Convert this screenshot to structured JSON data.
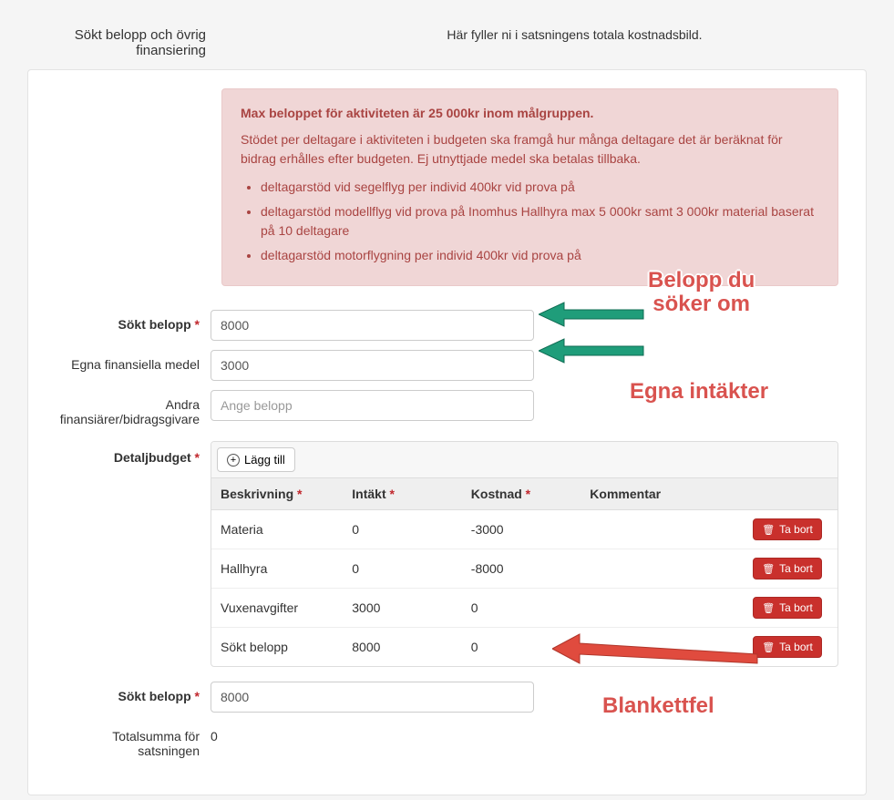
{
  "header": {
    "section_title_l1": "Sökt belopp och övrig",
    "section_title_l2": "finansiering",
    "description": "Här fyller ni i satsningens totala kostnadsbild."
  },
  "alert": {
    "heading": "Max beloppet för aktiviteten är 25 000kr inom målgruppen.",
    "body": "Stödet per deltagare i aktiviteten i budgeten ska framgå hur många deltagare det är beräknat för bidrag erhålles efter budgeten. Ej utnyttjade medel ska betalas tillbaka.",
    "bullets": [
      "deltagarstöd vid segelflyg per individ 400kr vid prova på",
      "deltagarstöd modellflyg vid prova på Inomhus Hallhyra max 5 000kr samt 3 000kr material baserat på 10 deltagare",
      "deltagarstöd motorflygning per individ 400kr vid prova på"
    ]
  },
  "labels": {
    "sokt_belopp": "Sökt belopp",
    "egna_medel": "Egna finansiella medel",
    "andra_l1": "Andra",
    "andra_l2": "finansiärer/bidragsgivare",
    "detaljbudget": "Detaljbudget",
    "sokt_belopp2": "Sökt belopp",
    "totalsumma_l1": "Totalsumma för",
    "totalsumma_l2": "satsningen",
    "add_button": "Lägg till",
    "delete_button": "Ta bort",
    "andra_placeholder": "Ange belopp"
  },
  "values": {
    "sokt_belopp": "8000",
    "egna_medel": "3000",
    "andra": "",
    "sokt_belopp2": "8000",
    "totalsumma": "0"
  },
  "table": {
    "headers": {
      "beskrivning": "Beskrivning",
      "intakt": "Intäkt",
      "kostnad": "Kostnad",
      "kommentar": "Kommentar"
    },
    "rows": [
      {
        "beskrivning": "Materia",
        "intakt": "0",
        "kostnad": "-3000",
        "kommentar": ""
      },
      {
        "beskrivning": "Hallhyra",
        "intakt": "0",
        "kostnad": "-8000",
        "kommentar": ""
      },
      {
        "beskrivning": "Vuxenavgifter",
        "intakt": "3000",
        "kostnad": "0",
        "kommentar": ""
      },
      {
        "beskrivning": "Sökt belopp",
        "intakt": "8000",
        "kostnad": "0",
        "kommentar": ""
      }
    ]
  },
  "annotations": {
    "a1_l1": "Belopp du",
    "a1_l2": "söker om",
    "a2": "Egna intäkter",
    "a3": "Blankettfel"
  }
}
